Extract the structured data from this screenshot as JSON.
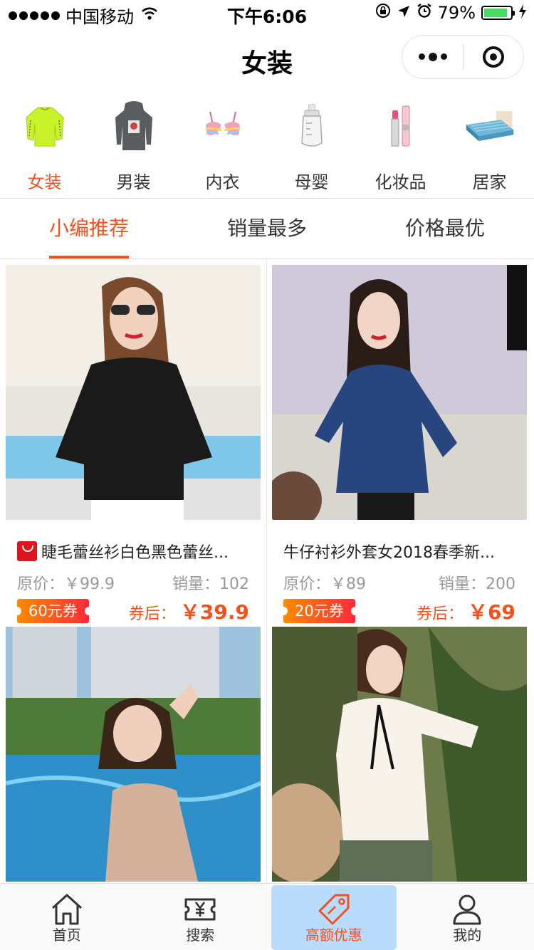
{
  "status_bar": {
    "carrier": "中国移动",
    "time": "下午6:06",
    "battery": "79%"
  },
  "nav": {
    "title": "女装"
  },
  "categories": [
    {
      "label": "女装",
      "icon": "sweater-icon",
      "active": true
    },
    {
      "label": "男装",
      "icon": "hoodie-icon",
      "active": false
    },
    {
      "label": "内衣",
      "icon": "bra-icon",
      "active": false
    },
    {
      "label": "母婴",
      "icon": "baby-bottle-icon",
      "active": false
    },
    {
      "label": "化妆品",
      "icon": "lipstick-icon",
      "active": false
    },
    {
      "label": "居家",
      "icon": "bed-icon",
      "active": false
    }
  ],
  "sort_tabs": [
    {
      "label": "小编推荐",
      "active": true
    },
    {
      "label": "销量最多",
      "active": false
    },
    {
      "label": "价格最优",
      "active": false
    }
  ],
  "products": [
    {
      "title": "睫毛蕾丝衫白色黑色蕾丝...",
      "tmall_badge": true,
      "original_label": "原价：",
      "original_price": "￥99.9",
      "sales_label": "销量：",
      "sales": "102",
      "coupon": "60元券",
      "after_label": "券后：",
      "after_price": "￥39.9"
    },
    {
      "title": "牛仔衬衫外套女2018春季新...",
      "tmall_badge": false,
      "original_label": "原价：",
      "original_price": "￥89",
      "sales_label": "销量：",
      "sales": "200",
      "coupon": "20元券",
      "after_label": "券后：",
      "after_price": "￥69"
    },
    {
      "title": "",
      "image": "model-in-pool-photo"
    },
    {
      "title": "",
      "image": "model-white-blouse-photo"
    }
  ],
  "tabbar": [
    {
      "label": "首页",
      "icon": "home-icon",
      "active": false
    },
    {
      "label": "搜索",
      "icon": "ticket-yen-icon",
      "active": false
    },
    {
      "label": "高额优惠",
      "icon": "price-tag-icon",
      "active": true
    },
    {
      "label": "我的",
      "icon": "user-icon",
      "active": false
    }
  ],
  "colors": {
    "accent": "#f4511e",
    "battery": "#4cd964",
    "tabbar_highlight": "#b9dcfd"
  }
}
